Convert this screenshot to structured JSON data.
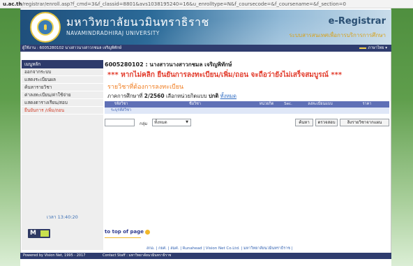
{
  "browser": {
    "url_host": "u.ac.th",
    "url_path": "/registrar/enroll.asp?f_cmd=3&f_classid=8801&avs1038195240=16&u_enrolltype=N&f_coursecode=&f_coursename=&f_section=0"
  },
  "header": {
    "university_th": "มหาวิทยาลัยนวมินทราธิราช",
    "university_en": "NAVAMINDRADHIRAJ  UNIVERSITY",
    "system_title": "e-Registrar",
    "system_subtitle": "ระบบสารสนเทศเพื่อการบริการการศึกษา"
  },
  "userbar": {
    "text": "ผู้ใช้งาน : 6005280102 นางสาวนางสาวกชมล เจริญพิทักษ์",
    "language_label": "ภาษาไทย ▾",
    "accent_color": "#f7d24e"
  },
  "sidebar": {
    "title": "เมนูหลัก",
    "items": [
      {
        "label": "ออกจากระบบ",
        "active": false
      },
      {
        "label": "แสดงระเบียนผล",
        "active": false
      },
      {
        "label": "ค้นหารายวิชา",
        "active": false
      },
      {
        "label": "ค่าลงทะเบียน/ค่าใช้จ่าย",
        "active": false
      },
      {
        "label": "แสดงตารางเรียน/สอบ",
        "active": false
      },
      {
        "label": "ยืนยันการ /เพิ่ม/ถอน",
        "active": true
      }
    ],
    "time": "เวลา 13:40:20",
    "vendor_logo_letter": "M"
  },
  "main": {
    "student": "6005280102 : นางสาวนางสาวกชมล เจริญพิทักษ์",
    "warning": "*** หากไม่คลิก ยืนยันการลงทะเบียน/เพิ่ม/ถอน จะถือว่ายังไม่เสร็จสมบูรณ์ ***",
    "subtitle": "รายวิชาที่ต้องการลงทะเบียน",
    "term_label": "ภาคการศึกษาที่",
    "term_value": "2/2560",
    "term_select_text": "เลือกหน่วยกิตแบบ",
    "term_mode": "ปกติ",
    "term_link": "ทั้งหมด",
    "table_headers": [
      "รหัสวิชา",
      "ชื่อวิชา",
      "หน่วยกิต",
      "Sec.",
      "ลงทะเบียนแบบ",
      "ราคา"
    ],
    "table_rows": [
      [
        "ระบุรหัสวิชา"
      ]
    ],
    "group_label": "กลุ่ม",
    "group_value": "ทั้งหมด",
    "buttons": {
      "search": "ค้นหา",
      "check": "ตรวจสอบ",
      "delete": "ลิงรายวิชาจากแผน"
    },
    "top_of_page": "to top of page"
  },
  "footer": {
    "links": "สกอ. | กยศ. | สมศ. | Runahead | Vision Net Co.Ltd. | มหาวิทยาลัยนวมินทราธิราช |",
    "powered": "Powered by Vision Net, 1995 - 2017",
    "contact": "Contact Staff : มหาวิทยาลัยนวมินทราธิราช"
  },
  "colors": {
    "nav_head": "#2e3b6b",
    "warning": "#e23a2a",
    "subtitle": "#f07c1f",
    "table_head": "#5f70b6",
    "side_green": "#5f9e4c"
  }
}
